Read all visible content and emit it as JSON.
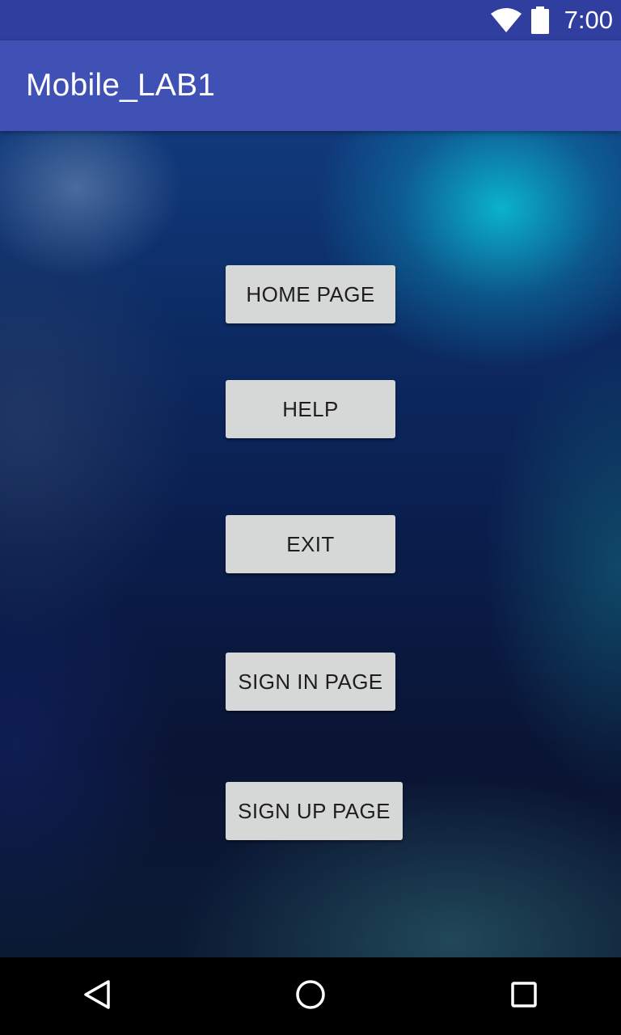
{
  "status_bar": {
    "time": "7:00",
    "icons": [
      "wifi-icon",
      "battery-icon"
    ],
    "background": "#303f9f"
  },
  "action_bar": {
    "title": "Mobile_LAB1",
    "background": "#3f51b5"
  },
  "buttons": [
    {
      "id": "home",
      "label": "HOME PAGE"
    },
    {
      "id": "help",
      "label": "HELP"
    },
    {
      "id": "exit",
      "label": "EXIT"
    },
    {
      "id": "sign_in",
      "label": "SIGN IN PAGE"
    },
    {
      "id": "sign_up",
      "label": "SIGN UP PAGE"
    }
  ],
  "nav_bar": {
    "icons": [
      "back-icon",
      "home-circle-icon",
      "recents-icon"
    ],
    "background": "#000000"
  },
  "colors": {
    "button_background": "#d6d7d7",
    "button_text": "#1e1e1e"
  }
}
